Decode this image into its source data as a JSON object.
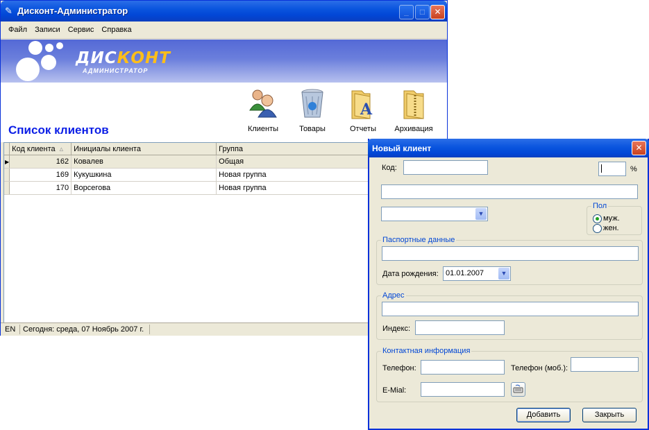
{
  "main_window": {
    "title": "Дисконт-Администратор",
    "menu": [
      "Файл",
      "Записи",
      "Сервис",
      "Справка"
    ],
    "banner": {
      "brand_part1": "ДИС",
      "brand_part2": "КОНТ",
      "subtitle": "АДМИНИСТРАТОР"
    },
    "page_title": "Список клиентов",
    "toolbar": [
      {
        "label": "Клиенты",
        "icon": "clients-icon"
      },
      {
        "label": "Товары",
        "icon": "recycle-bin-icon"
      },
      {
        "label": "Отчеты",
        "icon": "reports-folder-icon"
      },
      {
        "label": "Архивация",
        "icon": "archive-folder-icon"
      }
    ],
    "table": {
      "columns": [
        "Код клиента",
        "Инициалы клиента",
        "Группа"
      ],
      "rows": [
        {
          "code": "162",
          "name": "Ковалев",
          "group": "Общая"
        },
        {
          "code": "169",
          "name": "Кукушкина",
          "group": "Новая группа"
        },
        {
          "code": "170",
          "name": "Ворсегова",
          "group": "Новая группа"
        }
      ]
    },
    "status": {
      "lang": "EN",
      "today": "Сегодня:  среда, 07 Ноябрь 2007 г."
    }
  },
  "dialog": {
    "title": "Новый клиент",
    "code_label": "Код:",
    "percent_label": "%",
    "gender": {
      "title": "Пол",
      "male": "муж.",
      "female": "жен.",
      "selected": "male"
    },
    "passport_group": "Паспортные данные",
    "birth_label": "Дата рождения:",
    "birth_value": "01.01.2007",
    "address_group": "Адрес",
    "index_label": "Индекс:",
    "contact_group": "Контактная информация",
    "phone_label": "Телефон:",
    "mobile_label": "Телефон (моб.):",
    "email_label": "E-Mial:",
    "add_button": "Добавить",
    "close_button": "Закрыть"
  },
  "colors": {
    "title_blue": "#0a55de",
    "page_title": "#0b1ee6",
    "group_title": "#0046d5",
    "brand_accent": "#ffbe1a"
  }
}
